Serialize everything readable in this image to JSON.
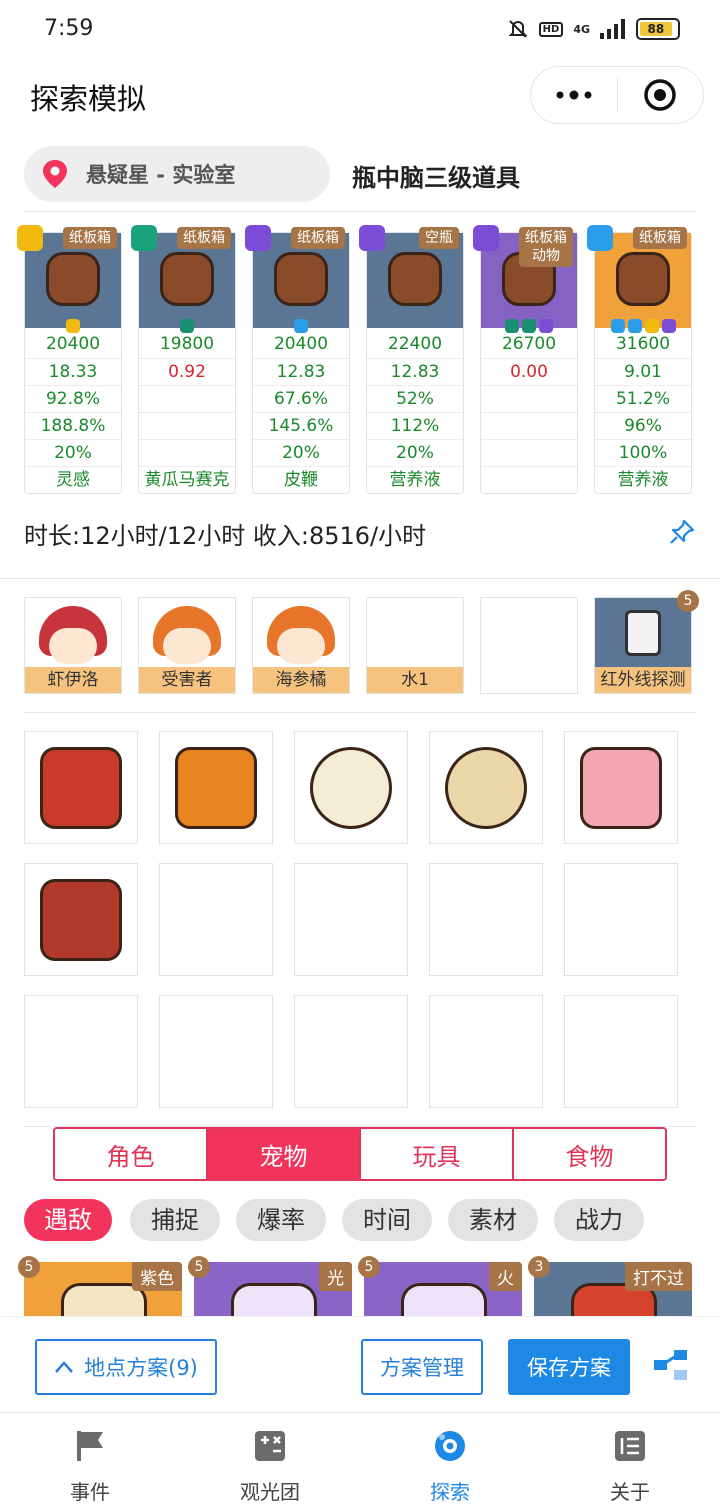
{
  "status": {
    "time": "7:59",
    "hd": "HD",
    "network": "4G",
    "battery": "88"
  },
  "header": {
    "title": "探索模拟"
  },
  "location": {
    "name": "悬疑星 - 实验室",
    "subtitle": "瓶中脑三级道具"
  },
  "items": [
    {
      "tag": "纸板箱",
      "tag2": "",
      "stats": [
        "20400",
        "18.33",
        "92.8%",
        "188.8%",
        "20%",
        "灵感"
      ],
      "red": [],
      "img_color": "#5b7594"
    },
    {
      "tag": "纸板箱",
      "tag2": "",
      "stats": [
        "19800",
        "0.92",
        "",
        "",
        "",
        "黄瓜马赛克"
      ],
      "red": [
        1
      ],
      "img_color": "#5b7594"
    },
    {
      "tag": "纸板箱",
      "tag2": "",
      "stats": [
        "20400",
        "12.83",
        "67.6%",
        "145.6%",
        "20%",
        "皮鞭"
      ],
      "red": [],
      "img_color": "#5b7594"
    },
    {
      "tag": "空瓶",
      "tag2": "",
      "stats": [
        "22400",
        "12.83",
        "52%",
        "112%",
        "20%",
        "营养液"
      ],
      "red": [],
      "img_color": "#5b7594"
    },
    {
      "tag": "纸板箱",
      "tag2": "动物",
      "stats": [
        "26700",
        "0.00",
        "",
        "",
        "",
        ""
      ],
      "red": [
        1
      ],
      "img_color": "#8463c4"
    },
    {
      "tag": "纸板箱",
      "tag2": "",
      "stats": [
        "31600",
        "9.01",
        "51.2%",
        "96%",
        "100%",
        "营养液"
      ],
      "red": [],
      "img_color": "#f0a13a"
    }
  ],
  "info": {
    "text": "时长:12小时/12小时 收入:8516/小时"
  },
  "roles": [
    {
      "label": "虾伊洛",
      "count": ""
    },
    {
      "label": "受害者",
      "count": ""
    },
    {
      "label": "海参橘",
      "count": ""
    },
    {
      "label": "水1",
      "count": ""
    },
    {
      "label": "",
      "count": ""
    },
    {
      "label": "红外线探测",
      "count": "5"
    }
  ],
  "tabs": [
    {
      "label": "角色",
      "active": false
    },
    {
      "label": "宠物",
      "active": true
    },
    {
      "label": "玩具",
      "active": false
    },
    {
      "label": "食物",
      "active": false
    }
  ],
  "filters": [
    {
      "label": "遇敌",
      "active": true
    },
    {
      "label": "捕捉",
      "active": false
    },
    {
      "label": "爆率",
      "active": false
    },
    {
      "label": "时间",
      "active": false
    },
    {
      "label": "素材",
      "active": false
    },
    {
      "label": "战力",
      "active": false
    }
  ],
  "cards": [
    {
      "count": "5",
      "tag": "紫色",
      "color": "#f0a13a"
    },
    {
      "count": "5",
      "tag": "光",
      "color": "#8a64c6"
    },
    {
      "count": "5",
      "tag": "火",
      "color": "#8a64c6"
    },
    {
      "count": "3",
      "tag": "打不过",
      "color": "#5b7594"
    }
  ],
  "actions": {
    "plans": "地点方案(9)",
    "manage": "方案管理",
    "save": "保存方案"
  },
  "nav": [
    {
      "label": "事件",
      "icon": "flag-icon",
      "active": false
    },
    {
      "label": "观光团",
      "icon": "calculator-icon",
      "active": false
    },
    {
      "label": "探索",
      "icon": "explore-icon",
      "active": true
    },
    {
      "label": "关于",
      "icon": "list-icon",
      "active": false
    }
  ]
}
